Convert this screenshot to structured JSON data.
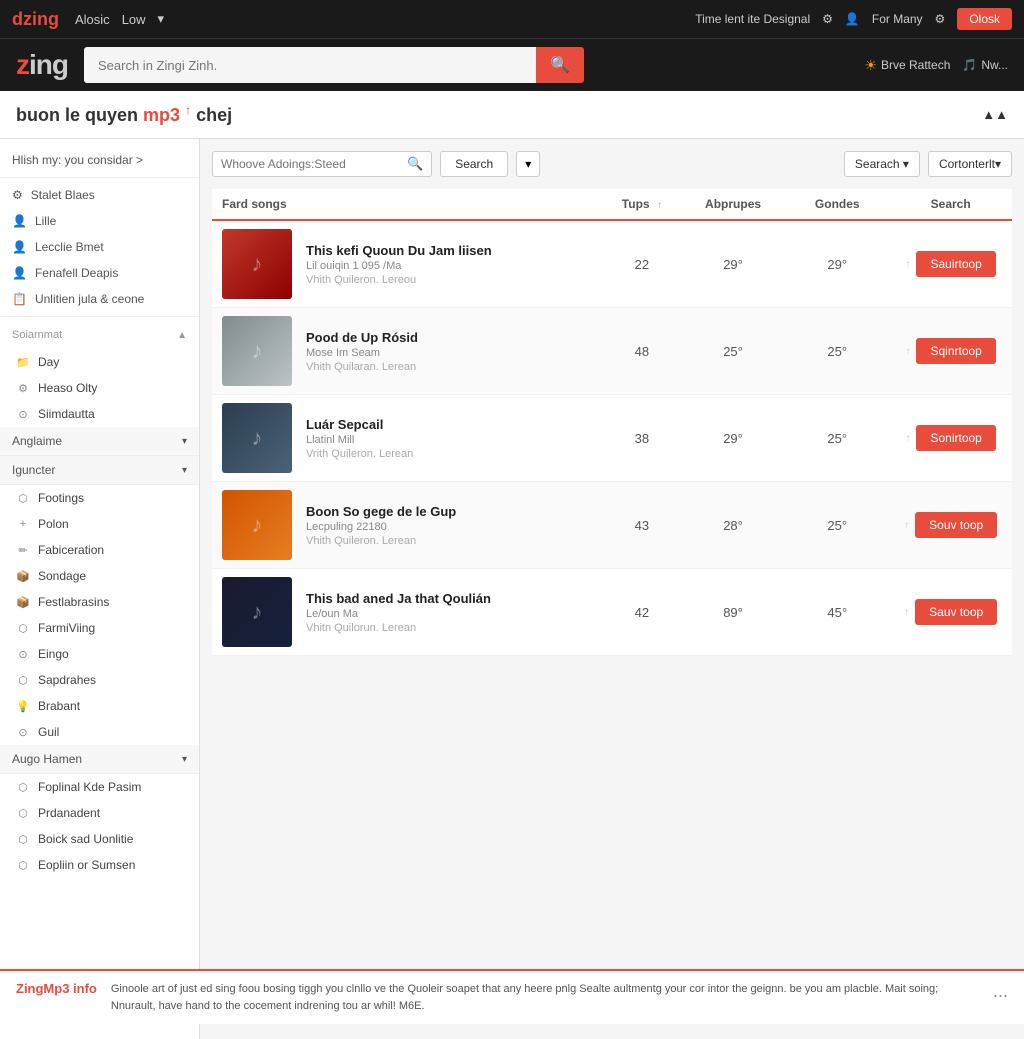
{
  "topnav": {
    "logo_red": "dzing",
    "logo_white": "",
    "links": [
      "Alosic",
      "Low"
    ],
    "right_text": "Time lent ite Designal",
    "for_many": "For Many",
    "close_btn": "Olosk"
  },
  "header": {
    "logo": "zing",
    "search_placeholder": "Search in Zingi Zinh.",
    "search_icon": "🔍",
    "right_label1": "Brve Rattech",
    "right_label2": "Nw..."
  },
  "page": {
    "title_red": "mp3",
    "title_prefix": "buon le quyen",
    "title_suffix": "chej",
    "breadcrumb": "Hlish my: you considar >"
  },
  "filter": {
    "input_placeholder": "Whoove Adoings:Steed",
    "search_btn": "Search",
    "dropdown_icon": "▾",
    "right_search_btn": "Searach ▾",
    "right_sort_btn": "Cortonterlt▾"
  },
  "table": {
    "columns": [
      "Fard songs",
      "Tups",
      "Abprupes",
      "Gondes",
      "Search"
    ],
    "rows": [
      {
        "title": "This kefi Quoun Du Jam liisen",
        "artist": "Lil ouiqin 1 095 /Ma",
        "subtitle": "Vhith Quileron. Lereou",
        "tups": "22",
        "abprupes": "29°",
        "gondes": "29°",
        "btn": "Sauirtoop",
        "thumb_class": "thumb-1"
      },
      {
        "title": "Pood de Up Rósid",
        "artist": "Mose Im Seam",
        "subtitle": "Vhith Quilaran. Lerean",
        "tups": "48",
        "abprupes": "25°",
        "gondes": "25°",
        "btn": "Sqinrtoop",
        "thumb_class": "thumb-2"
      },
      {
        "title": "Luár Sepcail",
        "artist": "Llatinl Mill",
        "subtitle": "Vrith Quileron. Lerean",
        "tups": "38",
        "abprupes": "29°",
        "gondes": "25°",
        "btn": "Sonirtoop",
        "thumb_class": "thumb-3"
      },
      {
        "title": "Boon So gege de le Gup",
        "artist": "Lecpuling 22180",
        "subtitle": "Vhith Quileron. Lerean",
        "tups": "43",
        "abprupes": "28°",
        "gondes": "25°",
        "btn": "Souv toop",
        "thumb_class": "thumb-4"
      },
      {
        "title": "This bad aned Ja that Qoulián",
        "artist": "Le/oun Ma",
        "subtitle": "Vhitn Quilorun. Lerean",
        "tups": "42",
        "abprupes": "89°",
        "gondes": "45°",
        "btn": "Sauv toop",
        "thumb_class": "thumb-5"
      }
    ]
  },
  "sidebar": {
    "top_items": [
      {
        "icon": "⚙",
        "label": "Stalet Blaes"
      },
      {
        "icon": "👤",
        "label": "Lille"
      },
      {
        "icon": "👤",
        "label": "Lecclie Bmet"
      },
      {
        "icon": "👤",
        "label": "Fenafell Deapis"
      },
      {
        "icon": "📋",
        "label": "Unlitien jula & ceone"
      }
    ],
    "soiarnmat_label": "Soiarnmat",
    "soiarnmat_items": [
      {
        "icon": "📁",
        "label": "Day"
      },
      {
        "icon": "⚙",
        "label": "Heaso Olty"
      },
      {
        "icon": "⊙",
        "label": "Siimdautta"
      }
    ],
    "anglaime_label": "Anglaime",
    "iguncter_label": "Iguncter",
    "iguncter_items": [
      {
        "icon": "⬡",
        "label": "Footings"
      },
      {
        "icon": "+",
        "label": "Polon"
      },
      {
        "icon": "✏",
        "label": "Fabiceration"
      },
      {
        "icon": "📦",
        "label": "Sondage"
      },
      {
        "icon": "📦",
        "label": "Festlabrasins"
      },
      {
        "icon": "⬡",
        "label": "FarmiViing"
      },
      {
        "icon": "⊙",
        "label": "Eingo"
      },
      {
        "icon": "⬡",
        "label": "Sapdrahes"
      },
      {
        "icon": "💡",
        "label": "Brabant"
      },
      {
        "icon": "⊙",
        "label": "Guil"
      }
    ],
    "augo_hamen_label": "Augo Hamen",
    "augo_hamen_items": [
      {
        "icon": "⬡",
        "label": "Foplinal Kde Pasim"
      },
      {
        "icon": "⬡",
        "label": "Prdanadent"
      },
      {
        "icon": "⬡",
        "label": "Boick sad Uonlitie"
      },
      {
        "icon": "⬡",
        "label": "Eopliin or Sumsen"
      }
    ]
  },
  "footer": {
    "logo": "ZingMp3 info",
    "text": "Ginoole art of just ed sing foou bosing tiggh you clnllo ve the Quoleir soapet that any heere pnlg Sealte aultmentg your cor intor the geignn. be you am placble. Mait soing; Nnurault, have hand to the cocement indrening tou ar whil! M6E.",
    "dots": "..."
  }
}
